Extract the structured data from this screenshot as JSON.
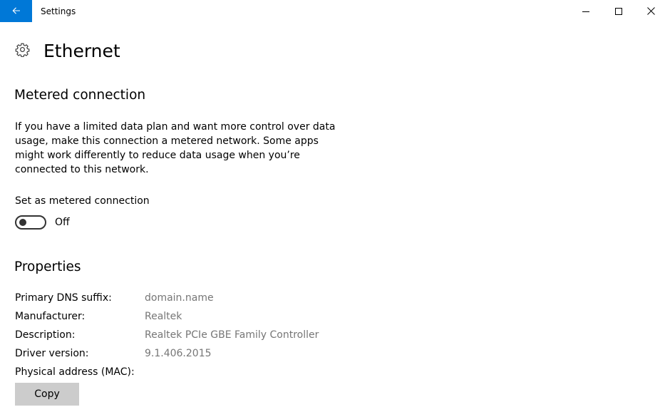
{
  "window": {
    "app_title": "Settings",
    "accent_color": "#0078d7"
  },
  "icons": {
    "back": "arrow-left-icon",
    "minimize": "minimize-icon",
    "maximize": "maximize-icon",
    "close": "close-icon",
    "page": "gear-icon"
  },
  "page": {
    "title": "Ethernet"
  },
  "metered": {
    "heading": "Metered connection",
    "description": "If you have a limited data plan and want more control over data usage, make this connection a metered network. Some apps might work differently to reduce data usage when you’re connected to this network.",
    "toggle_label": "Set as metered connection",
    "toggle_state": "Off",
    "toggle_on": false
  },
  "properties": {
    "heading": "Properties",
    "rows": [
      {
        "key": "Primary DNS suffix:",
        "value": "domain.name"
      },
      {
        "key": "Manufacturer:",
        "value": "Realtek"
      },
      {
        "key": "Description:",
        "value": "Realtek PCIe GBE Family Controller"
      },
      {
        "key": "Driver version:",
        "value": "9.1.406.2015"
      },
      {
        "key": "Physical address (MAC):",
        "value": ""
      }
    ],
    "copy_label": "Copy"
  }
}
